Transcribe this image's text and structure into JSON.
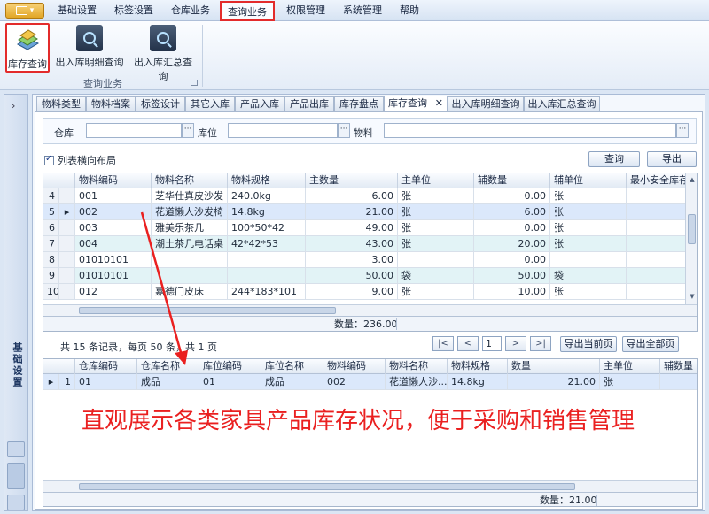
{
  "menu": {
    "items": [
      "基础设置",
      "标签设置",
      "仓库业务",
      "查询业务",
      "权限管理",
      "系统管理",
      "帮助"
    ],
    "active_index": 3
  },
  "ribbon": {
    "buttons": [
      "库存查询",
      "出入库明细查询",
      "出入库汇总查询"
    ],
    "group_label": "查询业务"
  },
  "leftdock": {
    "label": "基础设置"
  },
  "tabs": [
    "物料类型",
    "物料档案",
    "标签设计",
    "其它入库",
    "产品入库",
    "产品出库",
    "库存盘点",
    "库存查询",
    "出入库明细查询",
    "出入库汇总查询"
  ],
  "active_tab": 7,
  "filters": {
    "warehouse_label": "仓库",
    "location_label": "库位",
    "material_label": "物料",
    "dots": "···"
  },
  "options": {
    "horizontal_layout": "列表横向布局"
  },
  "buttons": {
    "query": "查询",
    "export": "导出",
    "export_page": "导出当前页",
    "export_all": "导出全部页"
  },
  "main_grid": {
    "headers": [
      "物料编码",
      "物料名称",
      "物料规格",
      "主数量",
      "主单位",
      "辅数量",
      "辅单位",
      "最小安全库存"
    ],
    "rows": [
      {
        "no": "4",
        "ind": "",
        "code": "001",
        "name": "芝华仕真皮沙发",
        "spec": "240.0kg",
        "qty": "6.00",
        "unit": "张",
        "aux_qty": "0.00",
        "aux_unit": "张",
        "min": ""
      },
      {
        "no": "5",
        "ind": "▸",
        "code": "002",
        "name": "花道懒人沙发椅",
        "spec": "14.8kg",
        "qty": "21.00",
        "unit": "张",
        "aux_qty": "6.00",
        "aux_unit": "张",
        "min": ""
      },
      {
        "no": "6",
        "ind": "",
        "code": "003",
        "name": "雅美乐茶几",
        "spec": "100*50*42",
        "qty": "49.00",
        "unit": "张",
        "aux_qty": "0.00",
        "aux_unit": "张",
        "min": ""
      },
      {
        "no": "7",
        "ind": "",
        "code": "004",
        "name": "潮土茶几电话桌",
        "spec": "42*42*53",
        "qty": "43.00",
        "unit": "张",
        "aux_qty": "20.00",
        "aux_unit": "张",
        "min": ""
      },
      {
        "no": "8",
        "ind": "",
        "code": "01010101",
        "name": "",
        "spec": "",
        "qty": "3.00",
        "unit": "",
        "aux_qty": "0.00",
        "aux_unit": "",
        "min": ""
      },
      {
        "no": "9",
        "ind": "",
        "code": "01010101",
        "name": "",
        "spec": "",
        "qty": "50.00",
        "unit": "袋",
        "aux_qty": "50.00",
        "aux_unit": "袋",
        "min": ""
      },
      {
        "no": "10",
        "ind": "",
        "code": "012",
        "name": "嘉德门皮床",
        "spec": "244*183*101",
        "qty": "9.00",
        "unit": "张",
        "aux_qty": "10.00",
        "aux_unit": "张",
        "min": ""
      }
    ],
    "footer": "数量：236.00"
  },
  "pager": {
    "summary": "共 15 条记录，每页 50 条，共 1 页",
    "first": "|<",
    "prev": "<",
    "page": "1",
    "next": ">",
    "last": ">|"
  },
  "detail_grid": {
    "headers": [
      "仓库编码",
      "仓库名称",
      "库位编码",
      "库位名称",
      "物料编码",
      "物料名称",
      "物料规格",
      "数量",
      "主单位",
      "辅数量"
    ],
    "rows": [
      {
        "ind": "▸",
        "no": "1",
        "wh_code": "01",
        "wh_name": "成品",
        "loc_code": "01",
        "loc_name": "成品",
        "mat_code": "002",
        "mat_name": "花道懒人沙...",
        "spec": "14.8kg",
        "qty": "21.00",
        "unit": "张",
        "aux": ""
      }
    ],
    "footer": "数量：21.00"
  },
  "annotation": "直观展示各类家具产品库存状况，便于采购和销售管理",
  "colors": {
    "accent_red": "#e32b2b",
    "annotation_red": "#ea2020",
    "row_alt": "#e2f3f6"
  }
}
